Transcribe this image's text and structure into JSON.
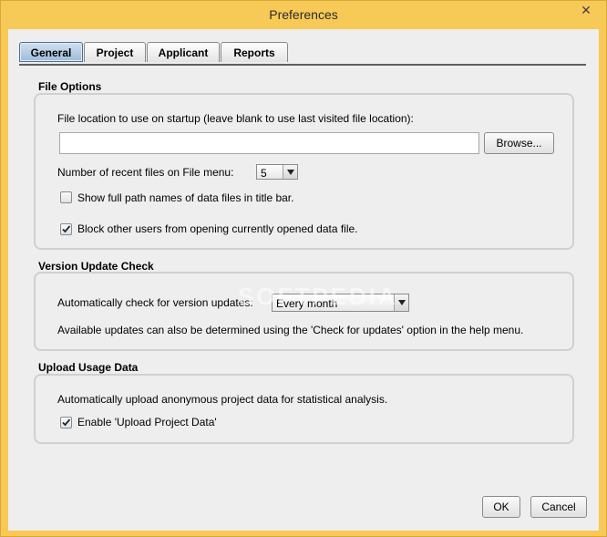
{
  "window": {
    "title": "Preferences",
    "close_glyph": "✕"
  },
  "tabs": [
    {
      "label": "General",
      "active": true
    },
    {
      "label": "Project",
      "active": false
    },
    {
      "label": "Applicant",
      "active": false
    },
    {
      "label": "Reports",
      "active": false
    }
  ],
  "file_options": {
    "title": "File Options",
    "location_label": "File location to use on startup (leave blank to use last visited file location):",
    "location_value": "",
    "browse_label": "Browse...",
    "recent_label": "Number of recent files on File menu:",
    "recent_value": "5",
    "show_path_label": "Show full path names of data files in title bar.",
    "show_path_checked": false,
    "block_users_label": "Block other users from opening currently opened data file.",
    "block_users_checked": true
  },
  "version_check": {
    "title": "Version Update Check",
    "auto_label": "Automatically check for version updates:",
    "auto_value": "Every month",
    "info_text": "Available updates can also be determined using the 'Check for updates' option in the help menu."
  },
  "upload_usage": {
    "title": "Upload Usage Data",
    "info_text": "Automatically upload anonymous project data for statistical analysis.",
    "enable_label": "Enable 'Upload Project Data'",
    "enable_checked": true
  },
  "footer": {
    "ok_label": "OK",
    "cancel_label": "Cancel"
  },
  "watermark": "SOFTPEDIA"
}
